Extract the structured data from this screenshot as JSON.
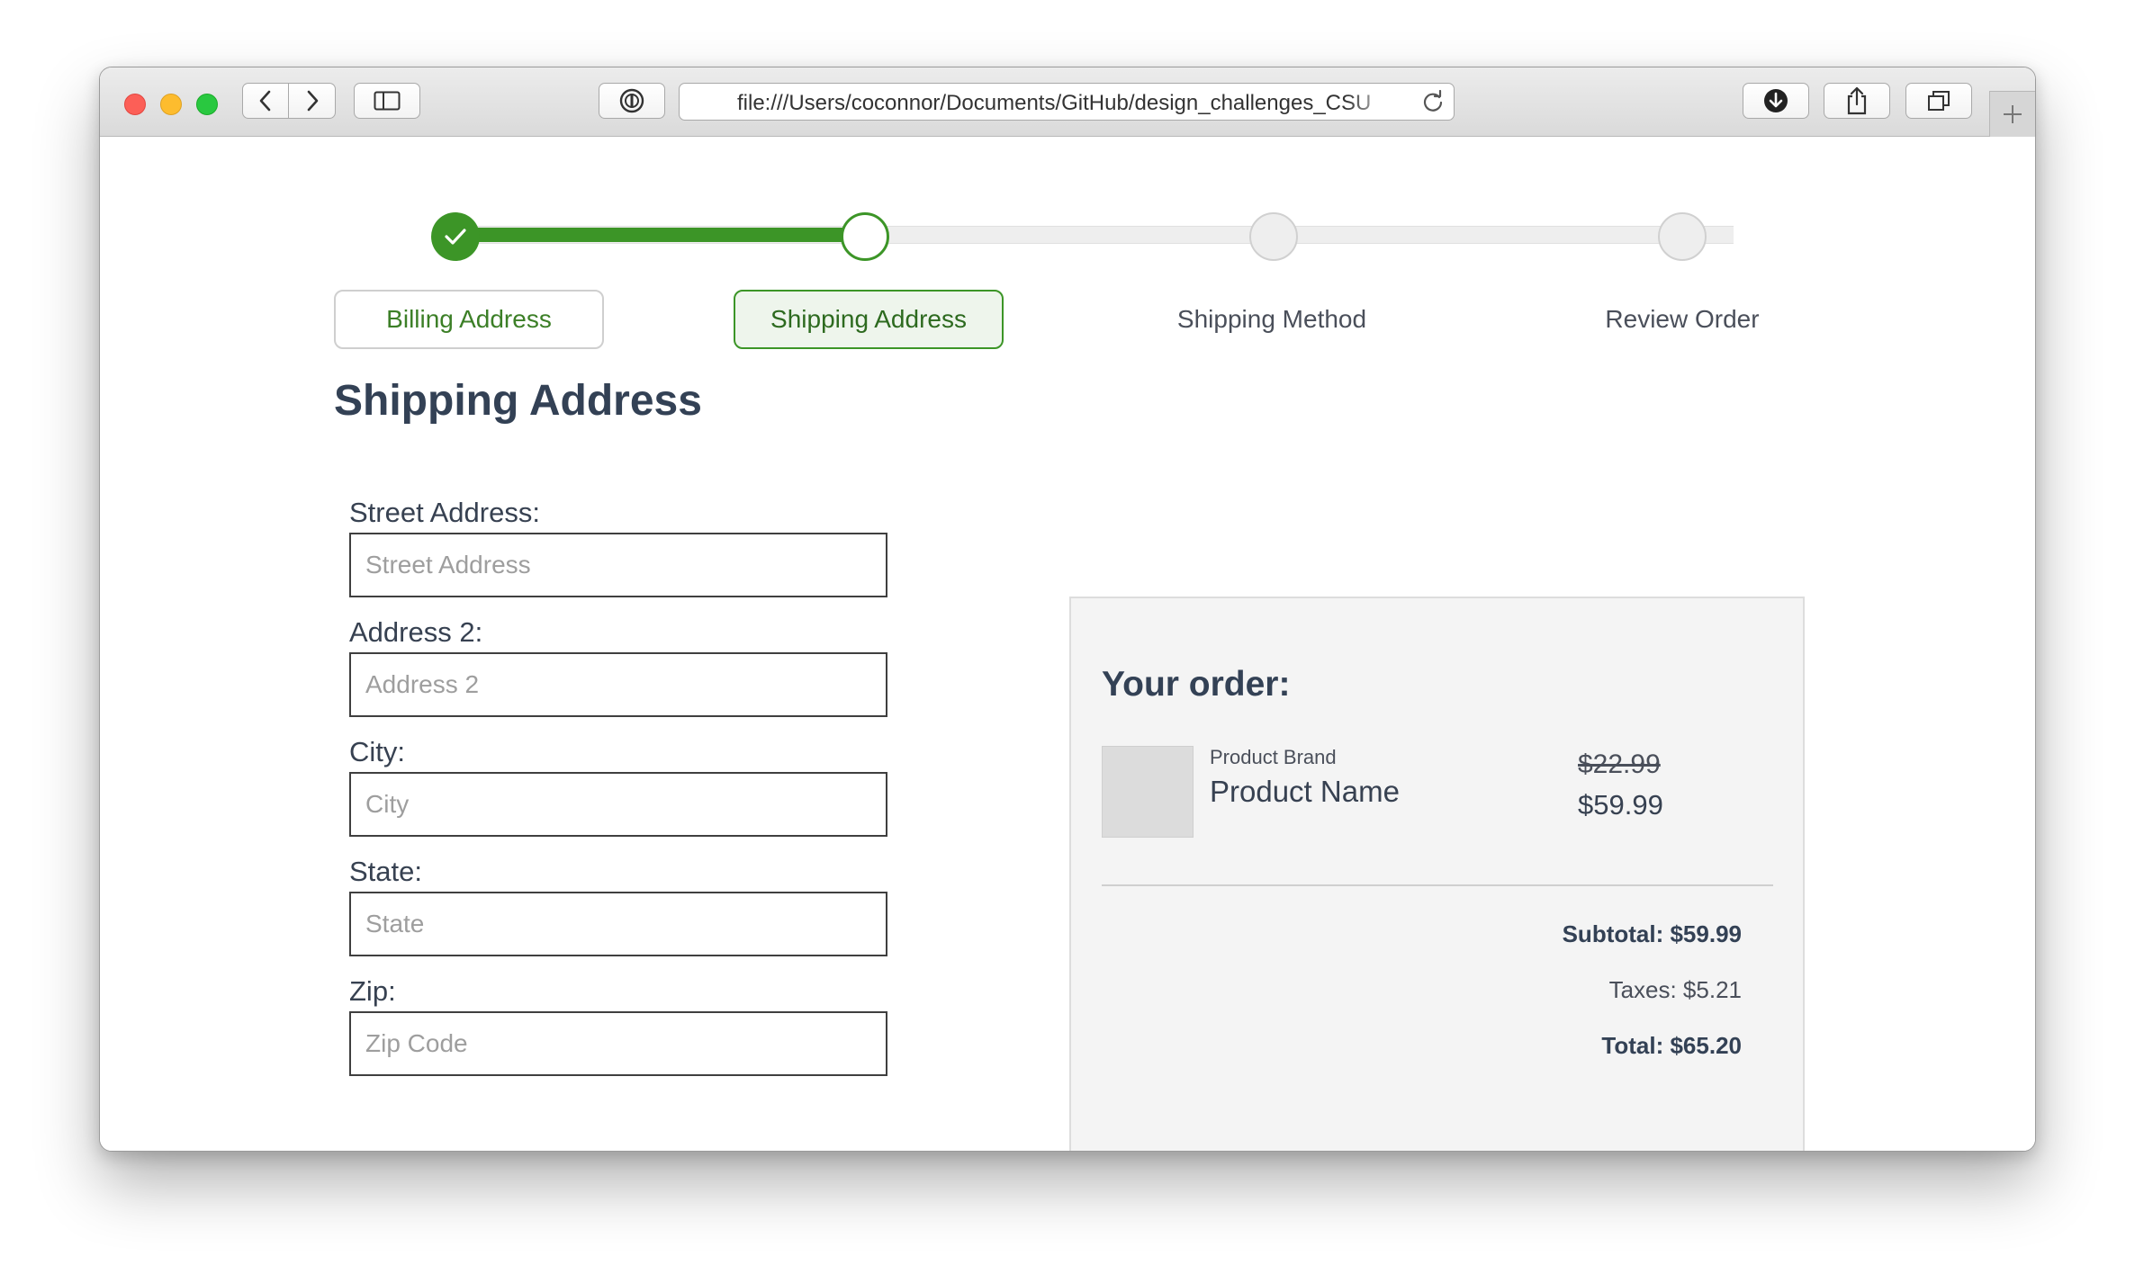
{
  "browser": {
    "url": "file:///Users/coconnor/Documents/GitHub/design_challenges_CSU"
  },
  "stepper": {
    "steps": [
      {
        "label": "Billing Address",
        "state": "complete"
      },
      {
        "label": "Shipping Address",
        "state": "active"
      },
      {
        "label": "Shipping Method",
        "state": "upcoming"
      },
      {
        "label": "Review Order",
        "state": "upcoming"
      }
    ],
    "progress_fraction": 0.333
  },
  "page": {
    "title": "Shipping Address"
  },
  "form": {
    "fields": [
      {
        "label": "Street Address:",
        "placeholder": "Street Address",
        "value": ""
      },
      {
        "label": "Address 2:",
        "placeholder": "Address 2",
        "value": ""
      },
      {
        "label": "City:",
        "placeholder": "City",
        "value": ""
      },
      {
        "label": "State:",
        "placeholder": "State",
        "value": ""
      },
      {
        "label": "Zip:",
        "placeholder": "Zip Code",
        "value": ""
      }
    ]
  },
  "order": {
    "heading": "Your order:",
    "item": {
      "brand": "Product Brand",
      "name": "Product Name",
      "original_price": "$22.99",
      "price": "$59.99"
    },
    "subtotal": "Subtotal: $59.99",
    "taxes": "Taxes: $5.21",
    "total": "Total: $65.20"
  },
  "colors": {
    "accent_green": "#3c9527",
    "heading_slate": "#334155",
    "panel_background": "#f4f4f4"
  }
}
